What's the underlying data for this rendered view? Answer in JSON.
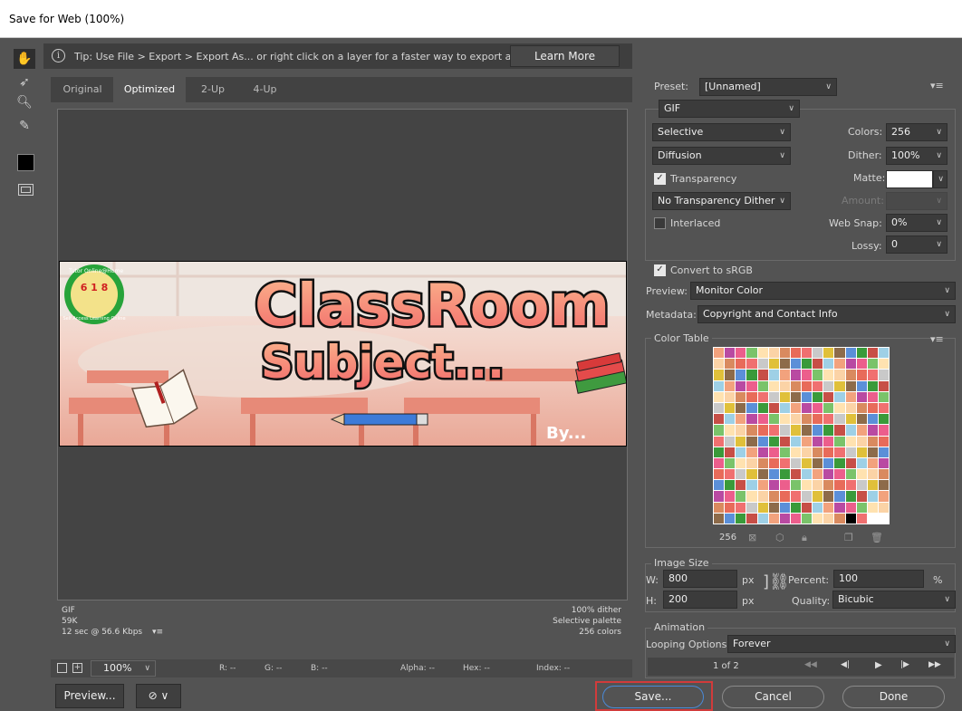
{
  "window": {
    "title": "Save for Web (100%)"
  },
  "tip": {
    "text": "Tip: Use File > Export > Export As... or right click on a layer for a faster way to export assets",
    "learn_more": "Learn More"
  },
  "tabs": [
    "Original",
    "Optimized",
    "2-Up",
    "4-Up"
  ],
  "image_text": {
    "line1": "ClassRoom",
    "line2": "Subject...",
    "byline": "By...",
    "badge": "Tutor Online@Home",
    "badge_nums": "6 1 8",
    "badge_bottom": "Self Access Learning Online"
  },
  "info_left": [
    "GIF",
    "59K",
    "12 sec @ 56.6 Kbps"
  ],
  "info_right": [
    "100% dither",
    "Selective palette",
    "256 colors"
  ],
  "status": {
    "zoom": "100%",
    "r": "R: --",
    "g": "G: --",
    "b": "B: --",
    "alpha": "Alpha: --",
    "hex": "Hex: --",
    "index": "Index: --"
  },
  "bottom": {
    "preview": "Preview...",
    "save": "Save...",
    "cancel": "Cancel",
    "done": "Done"
  },
  "panel": {
    "preset_label": "Preset:",
    "preset_value": "[Unnamed]",
    "format": "GIF",
    "reduction": "Selective",
    "dither_algo": "Diffusion",
    "colors_label": "Colors:",
    "colors_value": "256",
    "dither_label": "Dither:",
    "dither_value": "100%",
    "transparency_label": "Transparency",
    "transparency_checked": true,
    "matte_label": "Matte:",
    "trans_dither": "No Transparency Dither",
    "amount_label": "Amount:",
    "interlaced_label": "Interlaced",
    "interlaced_checked": false,
    "websnap_label": "Web Snap:",
    "websnap_value": "0%",
    "lossy_label": "Lossy:",
    "lossy_value": "0",
    "srgb_label": "Convert to sRGB",
    "srgb_checked": true,
    "preview_label": "Preview:",
    "preview_value": "Monitor Color",
    "metadata_label": "Metadata:",
    "metadata_value": "Copyright and Contact Info",
    "color_table_label": "Color Table",
    "color_count": "256",
    "image_size_label": "Image Size",
    "w_label": "W:",
    "w_value": "800",
    "h_label": "H:",
    "h_value": "200",
    "px": "px",
    "percent_label": "Percent:",
    "percent_value": "100",
    "pct_unit": "%",
    "quality_label": "Quality:",
    "quality_value": "Bicubic",
    "animation_label": "Animation",
    "looping_label": "Looping Options:",
    "looping_value": "Forever",
    "frame_counter": "1 of 2"
  },
  "colors": {
    "accent_outline": "#d13b3b",
    "panel_bg": "#535353",
    "title_orange": "#f7a07a"
  }
}
